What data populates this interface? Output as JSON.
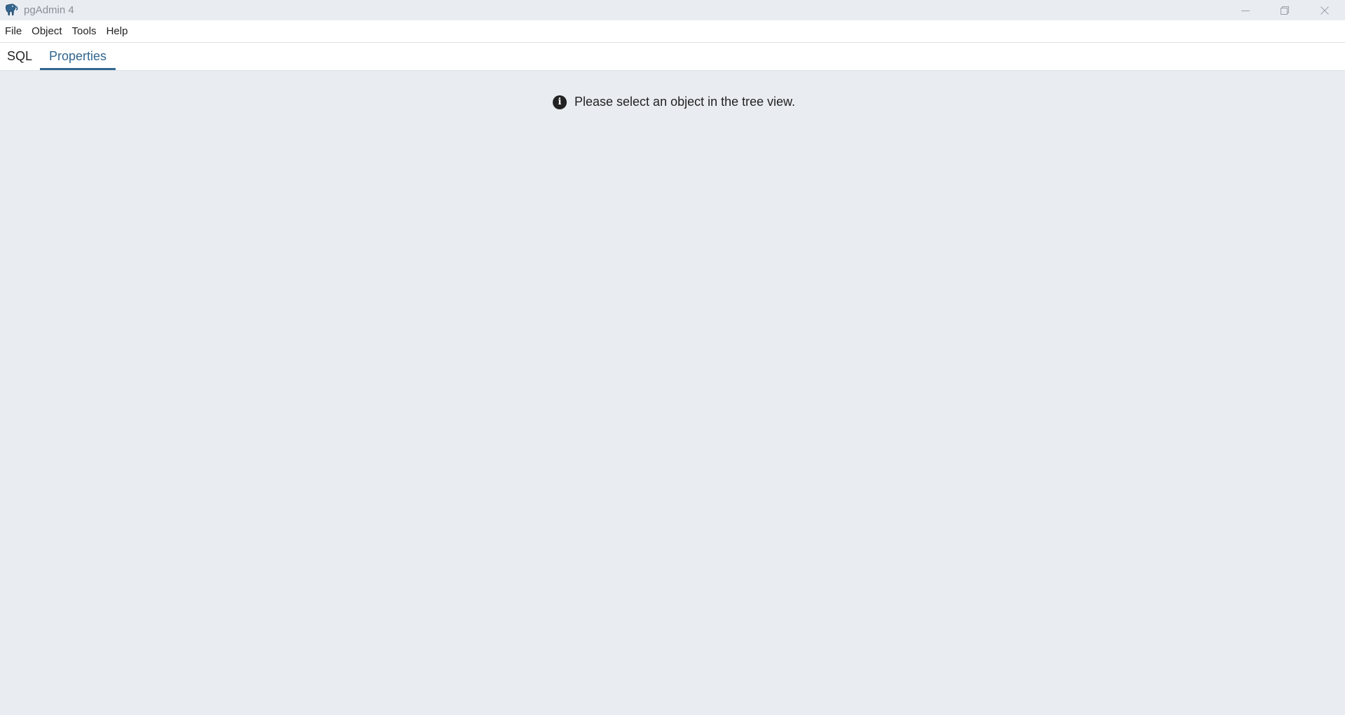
{
  "window": {
    "title": "pgAdmin 4",
    "icon": "elephant-logo-icon",
    "controls": [
      "minimize-icon",
      "restore-icon",
      "close-icon"
    ]
  },
  "menubar": {
    "items": [
      {
        "label": "File"
      },
      {
        "label": "Object"
      },
      {
        "label": "Tools"
      },
      {
        "label": "Help"
      }
    ]
  },
  "tabs": {
    "items": [
      {
        "label": "SQL",
        "active": false
      },
      {
        "label": "Properties",
        "active": true
      }
    ]
  },
  "main": {
    "message": "Please select an object in the tree view.",
    "message_icon": "info-icon"
  },
  "colors": {
    "accent": "#326690",
    "background": "#e9edf2"
  }
}
